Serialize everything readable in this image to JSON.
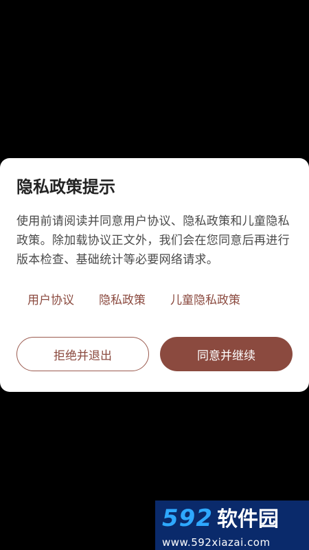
{
  "dialog": {
    "title": "隐私政策提示",
    "body": "使用前请阅读并同意用户协议、隐私政策和儿童隐私政策。除加载协议正文外，我们会在您同意后再进行版本检查、基础统计等必要网络请求。",
    "links": [
      {
        "label": "用户协议"
      },
      {
        "label": "隐私政策"
      },
      {
        "label": "儿童隐私政策"
      }
    ],
    "reject_label": "拒绝并退出",
    "accept_label": "同意并继续"
  },
  "watermark": {
    "number": "592",
    "name": "软件园",
    "url": "www.592xiazai.com"
  },
  "colors": {
    "accent": "#8b4a3f",
    "background": "#000000",
    "dialog_background": "#ffffff",
    "watermark_background": "#0a2a6b",
    "watermark_number": "#2ea8ff"
  }
}
